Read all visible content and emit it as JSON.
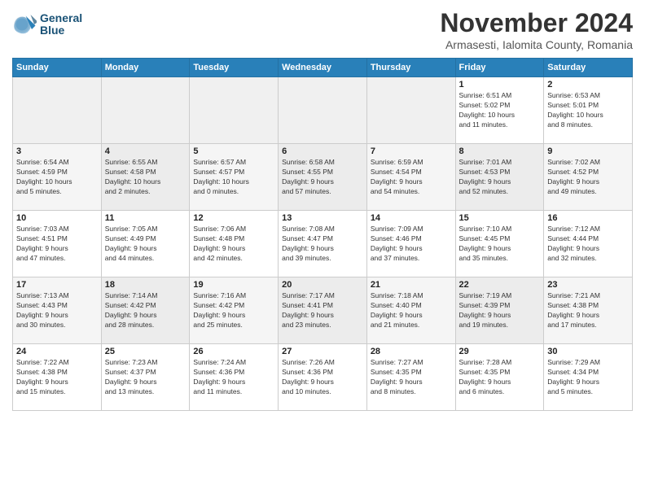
{
  "header": {
    "logo_line1": "General",
    "logo_line2": "Blue",
    "month_title": "November 2024",
    "location": "Armasesti, Ialomita County, Romania"
  },
  "days_of_week": [
    "Sunday",
    "Monday",
    "Tuesday",
    "Wednesday",
    "Thursday",
    "Friday",
    "Saturday"
  ],
  "weeks": [
    [
      {
        "day": "",
        "info": "",
        "empty": true
      },
      {
        "day": "",
        "info": "",
        "empty": true
      },
      {
        "day": "",
        "info": "",
        "empty": true
      },
      {
        "day": "",
        "info": "",
        "empty": true
      },
      {
        "day": "",
        "info": "",
        "empty": true
      },
      {
        "day": "1",
        "info": "Sunrise: 6:51 AM\nSunset: 5:02 PM\nDaylight: 10 hours\nand 11 minutes."
      },
      {
        "day": "2",
        "info": "Sunrise: 6:53 AM\nSunset: 5:01 PM\nDaylight: 10 hours\nand 8 minutes."
      }
    ],
    [
      {
        "day": "3",
        "info": "Sunrise: 6:54 AM\nSunset: 4:59 PM\nDaylight: 10 hours\nand 5 minutes."
      },
      {
        "day": "4",
        "info": "Sunrise: 6:55 AM\nSunset: 4:58 PM\nDaylight: 10 hours\nand 2 minutes."
      },
      {
        "day": "5",
        "info": "Sunrise: 6:57 AM\nSunset: 4:57 PM\nDaylight: 10 hours\nand 0 minutes."
      },
      {
        "day": "6",
        "info": "Sunrise: 6:58 AM\nSunset: 4:55 PM\nDaylight: 9 hours\nand 57 minutes."
      },
      {
        "day": "7",
        "info": "Sunrise: 6:59 AM\nSunset: 4:54 PM\nDaylight: 9 hours\nand 54 minutes."
      },
      {
        "day": "8",
        "info": "Sunrise: 7:01 AM\nSunset: 4:53 PM\nDaylight: 9 hours\nand 52 minutes."
      },
      {
        "day": "9",
        "info": "Sunrise: 7:02 AM\nSunset: 4:52 PM\nDaylight: 9 hours\nand 49 minutes."
      }
    ],
    [
      {
        "day": "10",
        "info": "Sunrise: 7:03 AM\nSunset: 4:51 PM\nDaylight: 9 hours\nand 47 minutes."
      },
      {
        "day": "11",
        "info": "Sunrise: 7:05 AM\nSunset: 4:49 PM\nDaylight: 9 hours\nand 44 minutes."
      },
      {
        "day": "12",
        "info": "Sunrise: 7:06 AM\nSunset: 4:48 PM\nDaylight: 9 hours\nand 42 minutes."
      },
      {
        "day": "13",
        "info": "Sunrise: 7:08 AM\nSunset: 4:47 PM\nDaylight: 9 hours\nand 39 minutes."
      },
      {
        "day": "14",
        "info": "Sunrise: 7:09 AM\nSunset: 4:46 PM\nDaylight: 9 hours\nand 37 minutes."
      },
      {
        "day": "15",
        "info": "Sunrise: 7:10 AM\nSunset: 4:45 PM\nDaylight: 9 hours\nand 35 minutes."
      },
      {
        "day": "16",
        "info": "Sunrise: 7:12 AM\nSunset: 4:44 PM\nDaylight: 9 hours\nand 32 minutes."
      }
    ],
    [
      {
        "day": "17",
        "info": "Sunrise: 7:13 AM\nSunset: 4:43 PM\nDaylight: 9 hours\nand 30 minutes."
      },
      {
        "day": "18",
        "info": "Sunrise: 7:14 AM\nSunset: 4:42 PM\nDaylight: 9 hours\nand 28 minutes."
      },
      {
        "day": "19",
        "info": "Sunrise: 7:16 AM\nSunset: 4:42 PM\nDaylight: 9 hours\nand 25 minutes."
      },
      {
        "day": "20",
        "info": "Sunrise: 7:17 AM\nSunset: 4:41 PM\nDaylight: 9 hours\nand 23 minutes."
      },
      {
        "day": "21",
        "info": "Sunrise: 7:18 AM\nSunset: 4:40 PM\nDaylight: 9 hours\nand 21 minutes."
      },
      {
        "day": "22",
        "info": "Sunrise: 7:19 AM\nSunset: 4:39 PM\nDaylight: 9 hours\nand 19 minutes."
      },
      {
        "day": "23",
        "info": "Sunrise: 7:21 AM\nSunset: 4:38 PM\nDaylight: 9 hours\nand 17 minutes."
      }
    ],
    [
      {
        "day": "24",
        "info": "Sunrise: 7:22 AM\nSunset: 4:38 PM\nDaylight: 9 hours\nand 15 minutes."
      },
      {
        "day": "25",
        "info": "Sunrise: 7:23 AM\nSunset: 4:37 PM\nDaylight: 9 hours\nand 13 minutes."
      },
      {
        "day": "26",
        "info": "Sunrise: 7:24 AM\nSunset: 4:36 PM\nDaylight: 9 hours\nand 11 minutes."
      },
      {
        "day": "27",
        "info": "Sunrise: 7:26 AM\nSunset: 4:36 PM\nDaylight: 9 hours\nand 10 minutes."
      },
      {
        "day": "28",
        "info": "Sunrise: 7:27 AM\nSunset: 4:35 PM\nDaylight: 9 hours\nand 8 minutes."
      },
      {
        "day": "29",
        "info": "Sunrise: 7:28 AM\nSunset: 4:35 PM\nDaylight: 9 hours\nand 6 minutes."
      },
      {
        "day": "30",
        "info": "Sunrise: 7:29 AM\nSunset: 4:34 PM\nDaylight: 9 hours\nand 5 minutes."
      }
    ]
  ]
}
